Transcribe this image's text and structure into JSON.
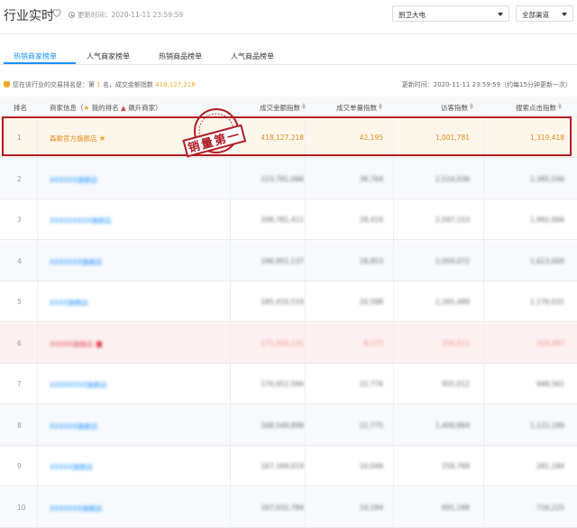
{
  "header": {
    "title": "行业实时",
    "update_label": "更新时间：2020-11-11 23:59:59",
    "category_select": "厨卫大电",
    "channel_select": "全部渠道"
  },
  "tabs": [
    {
      "label": "热销商家榜单"
    },
    {
      "label": "人气商家榜单"
    },
    {
      "label": "热销商品榜单"
    },
    {
      "label": "人气商品榜单"
    }
  ],
  "info": {
    "rank_prefix": "您在该行业的交易排名是：第",
    "rank_value": "1",
    "rank_mid": "名，成交金额指数",
    "rank_amount": "418,127,218",
    "updated": "更新时间：2020-11-11 23:59:59（约每15分钟更新一次）"
  },
  "table": {
    "headers": [
      "排名",
      "商家信息（",
      "我的排名",
      "飙升商家）",
      "成交金额指数",
      "成交单量指数",
      "访客指数",
      "搜索点击指数"
    ],
    "rows": [
      {
        "rank": "1",
        "name": "森歌官方旗舰店",
        "amount": "418,127,218",
        "orders": "42,195",
        "visitors": "1,001,781",
        "search": "1,319,418"
      },
      {
        "rank": "2",
        "name": "XXXXXX旗舰店",
        "amount": "223,781,066",
        "orders": "38,764",
        "visitors": "2,514,036",
        "search": "2,385,546"
      },
      {
        "rank": "3",
        "name": "XXXXXXXXX旗舰店",
        "amount": "208,781,411",
        "orders": "28,419",
        "visitors": "2,597,153",
        "search": "1,992,006"
      },
      {
        "rank": "4",
        "name": "XXXXXXX旗舰店",
        "amount": "196,951,137",
        "orders": "18,853",
        "visitors": "2,059,072",
        "search": "1,613,000"
      },
      {
        "rank": "5",
        "name": "XXXX旗舰店",
        "amount": "185,410,519",
        "orders": "20,588",
        "visitors": "2,265,489",
        "search": "2,176,031"
      },
      {
        "rank": "6",
        "name": "XXXXX旗舰店",
        "amount": "171,916,131",
        "orders": "8,273",
        "visitors": "259,511",
        "search": "318,487"
      },
      {
        "rank": "7",
        "name": "XXXXXXXX旗舰店",
        "amount": "170,052,584",
        "orders": "22,776",
        "visitors": "955,012",
        "search": "948,561"
      },
      {
        "rank": "8",
        "name": "XXXXXX旗舰店",
        "amount": "168,549,898",
        "orders": "22,775",
        "visitors": "1,409,864",
        "search": "1,122,189"
      },
      {
        "rank": "9",
        "name": "XXXXX旗舰店",
        "amount": "167,349,019",
        "orders": "10,048",
        "visitors": "259,789",
        "search": "281,184"
      },
      {
        "rank": "10",
        "name": "XXXXXXX旗舰店",
        "amount": "167,032,784",
        "orders": "14,184",
        "visitors": "691,188",
        "search": "716,225"
      }
    ]
  },
  "stamp": {
    "text": "销量第一"
  },
  "colors": {
    "accent": "#1890ff",
    "highlight": "#f5a623",
    "stamp": "#b01c27"
  }
}
